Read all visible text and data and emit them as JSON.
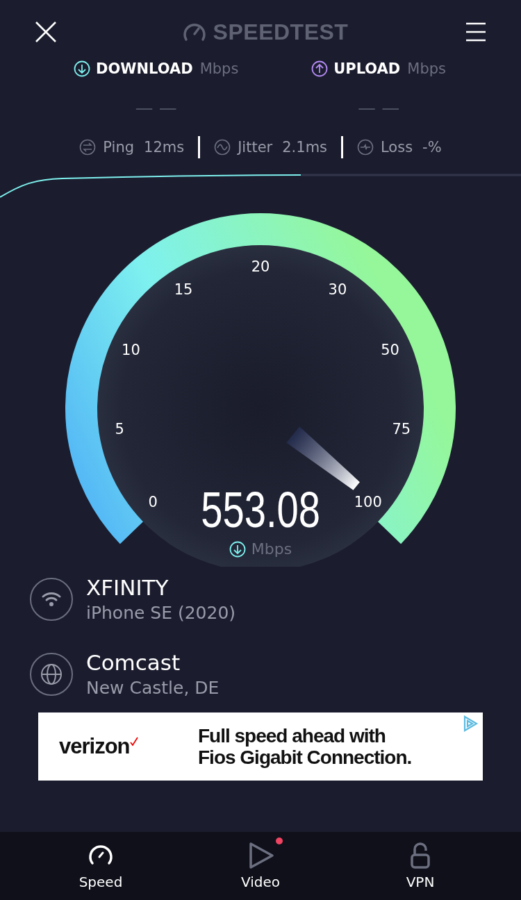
{
  "header": {
    "logo": "SPEEDTEST"
  },
  "results": [
    {
      "kind": "download",
      "label": "DOWNLOAD",
      "unit": "Mbps",
      "value": "— —"
    },
    {
      "kind": "upload",
      "label": "UPLOAD",
      "unit": "Mbps",
      "value": "— —"
    }
  ],
  "metrics": [
    {
      "kind": "ping",
      "label": "Ping",
      "value": "12ms"
    },
    {
      "kind": "jitter",
      "label": "Jitter",
      "value": "2.1ms"
    },
    {
      "kind": "loss",
      "label": "Loss",
      "value": "-%"
    }
  ],
  "gauge": {
    "ticks": [
      "0",
      "5",
      "10",
      "15",
      "20",
      "30",
      "50",
      "75",
      "100"
    ],
    "value": "553.08",
    "unit": "Mbps"
  },
  "connection": [
    {
      "kind": "wifi",
      "title": "XFINITY",
      "subtitle": "iPhone SE (2020)"
    },
    {
      "kind": "server",
      "title": "Comcast",
      "subtitle": "New Castle, DE"
    }
  ],
  "ad": {
    "brand": "verizon",
    "lines": [
      "Full speed ahead with",
      "Fios Gigabit Connection."
    ]
  },
  "tabs": [
    {
      "kind": "speed",
      "label": "Speed",
      "selected": true,
      "notification": false
    },
    {
      "kind": "video",
      "label": "Video",
      "selected": false,
      "notification": true
    },
    {
      "kind": "vpn",
      "label": "VPN",
      "selected": false,
      "notification": false
    }
  ]
}
